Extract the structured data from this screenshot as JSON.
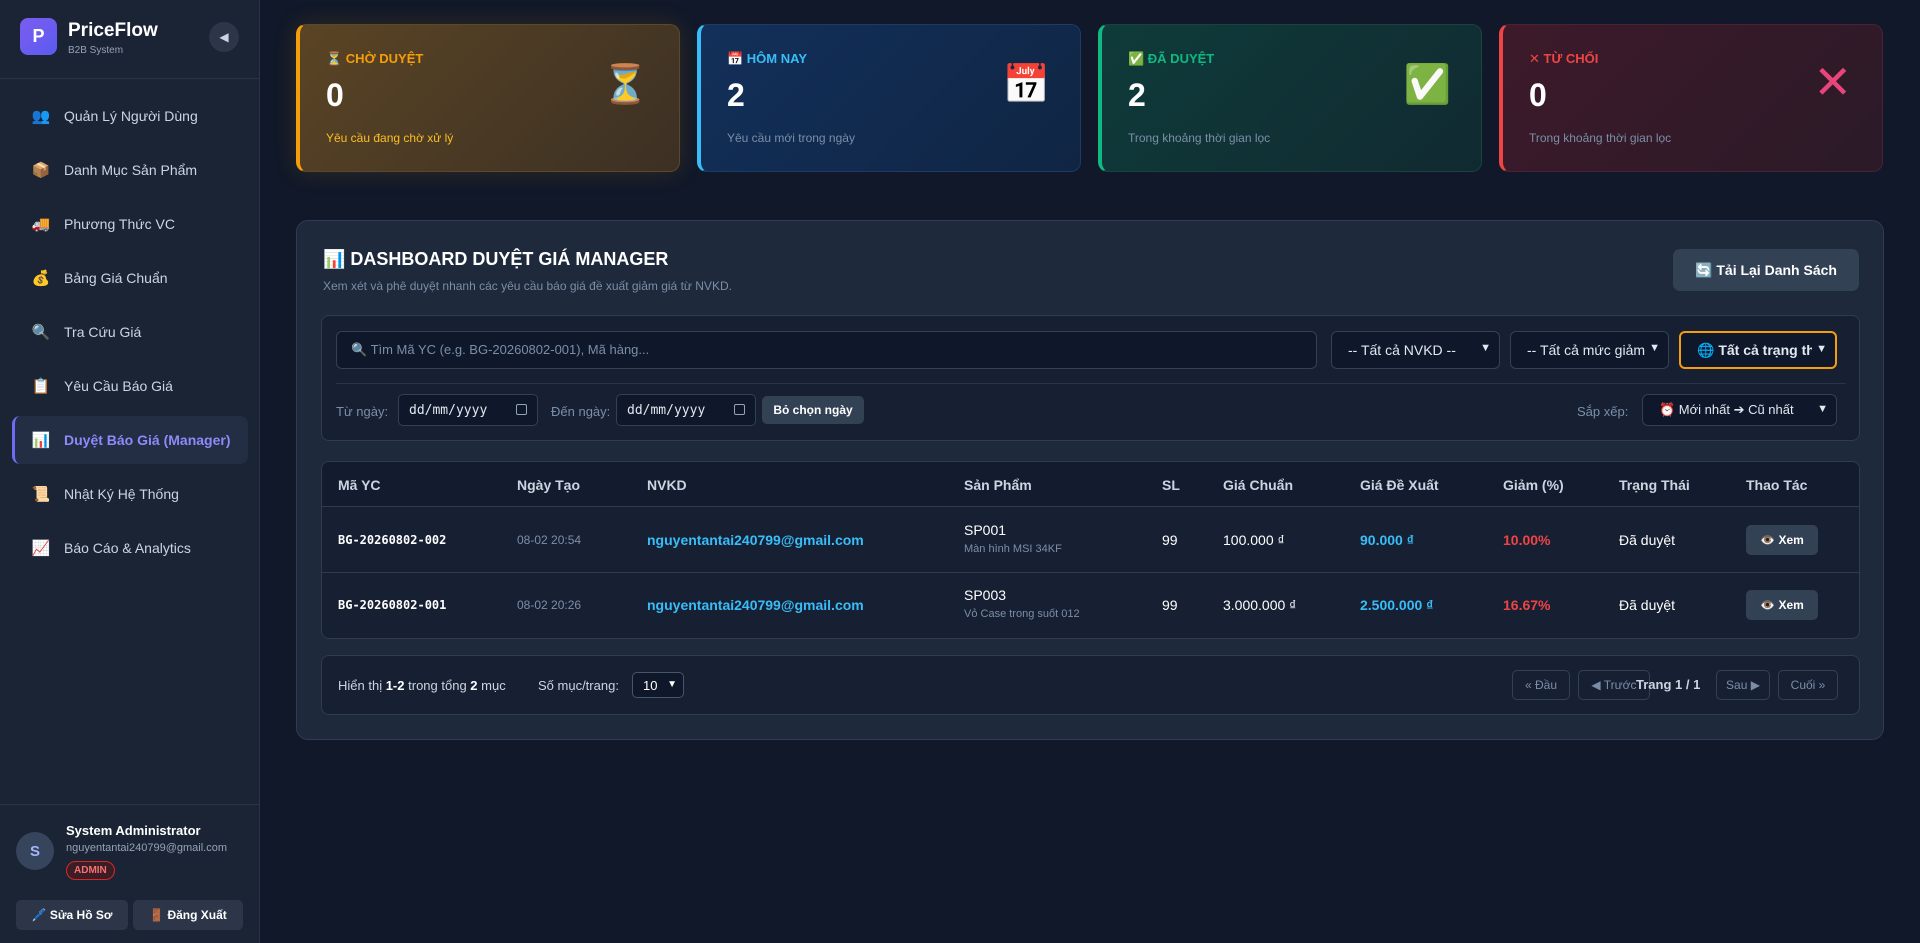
{
  "brand": {
    "logo_letter": "P",
    "name": "PriceFlow",
    "subtitle": "B2B System"
  },
  "sidebar": {
    "collapse_icon": "◀",
    "items": [
      {
        "icon": "👥",
        "label": "Quản Lý Người Dùng"
      },
      {
        "icon": "📦",
        "label": "Danh Mục Sản Phẩm"
      },
      {
        "icon": "🚚",
        "label": "Phương Thức VC"
      },
      {
        "icon": "💰",
        "label": "Bảng Giá Chuẩn"
      },
      {
        "icon": "🔍",
        "label": "Tra Cứu Giá"
      },
      {
        "icon": "📋",
        "label": "Yêu Cầu Báo Giá"
      },
      {
        "icon": "📊",
        "label": "Duyệt Báo Giá (Manager)",
        "active": true
      },
      {
        "icon": "📜",
        "label": "Nhật Ký Hệ Thống"
      },
      {
        "icon": "📈",
        "label": "Báo Cáo & Analytics"
      }
    ]
  },
  "user": {
    "avatar_letter": "S",
    "name": "System Administrator",
    "email": "nguyentantai240799@gmail.com",
    "role": "ADMIN",
    "edit_label": "🖊️ Sửa Hồ Sơ",
    "logout_label": "🚪 Đăng Xuất"
  },
  "stats": [
    {
      "title": "⏳ CHỜ DUYỆT",
      "value": "0",
      "desc": "Yêu cầu đang chờ xử lý",
      "icon": "⏳"
    },
    {
      "title": "📅 HÔM NAY",
      "value": "2",
      "desc": "Yêu cầu mới trong ngày",
      "icon": "📅"
    },
    {
      "title": "✅ ĐÃ DUYỆT",
      "value": "2",
      "desc": "Trong khoảng thời gian lọc",
      "icon": "✅"
    },
    {
      "title": "✕ TỪ CHỐI",
      "value": "0",
      "desc": "Trong khoảng thời gian lọc",
      "icon": "✕"
    }
  ],
  "panel": {
    "title": "📊 DASHBOARD DUYỆT GIÁ MANAGER",
    "subtitle": "Xem xét và phê duyệt nhanh các yêu cầu báo giá đề xuất giảm giá từ NVKD.",
    "reload_label": "🔄 Tải Lại Danh Sách"
  },
  "filters": {
    "search_placeholder": "🔍 Tìm Mã YC (e.g. BG-20260802-001), Mã hàng...",
    "nvkd": "-- Tất cả NVKD --",
    "level": "-- Tất cả mức giảm",
    "status": "🌐 Tất cả trạng thái",
    "from_label": "Từ ngày:",
    "to_label": "Đến ngày:",
    "date_placeholder": "dd/mm/yyyy",
    "clear_label": "Bỏ chọn ngày",
    "sort_label": "Sắp xếp:",
    "sort_value": "⏰ Mới nhất ➔ Cũ nhất"
  },
  "table": {
    "headers": [
      "Mã YC",
      "Ngày Tạo",
      "NVKD",
      "Sản Phẩm",
      "SL",
      "Giá Chuẩn",
      "Giá Đề Xuất",
      "Giảm (%)",
      "Trạng Thái",
      "Thao Tác"
    ],
    "rows": [
      {
        "id": "BG-20260802-002",
        "date": "08-02 20:54",
        "nvkd": "nguyentantai240799@gmail.com",
        "sku": "SP001",
        "product": "Màn hình MSI 34KF",
        "qty": "99",
        "std_price": "100.000 ₫",
        "proposed": "90.000 ₫",
        "discount": "10.00%",
        "status": "Đã duyệt",
        "action": "👁️ Xem"
      },
      {
        "id": "BG-20260802-001",
        "date": "08-02 20:26",
        "nvkd": "nguyentantai240799@gmail.com",
        "sku": "SP003",
        "product": "Vỏ Case trong suốt 012",
        "qty": "99",
        "std_price": "3.000.000 ₫",
        "proposed": "2.500.000 ₫",
        "discount": "16.67%",
        "status": "Đã duyệt",
        "action": "👁️ Xem"
      }
    ]
  },
  "pagination": {
    "show_prefix": "Hiển thị",
    "range": "1-2",
    "total_prefix": "trong tổng",
    "total": "2",
    "total_suffix": "mục",
    "per_page_label": "Số mục/trang:",
    "per_page": "10",
    "first": "« Đầu",
    "prev": "◀ Trước",
    "page": "Trang 1 / 1",
    "next": "Sau ▶",
    "last": "Cuối »"
  }
}
